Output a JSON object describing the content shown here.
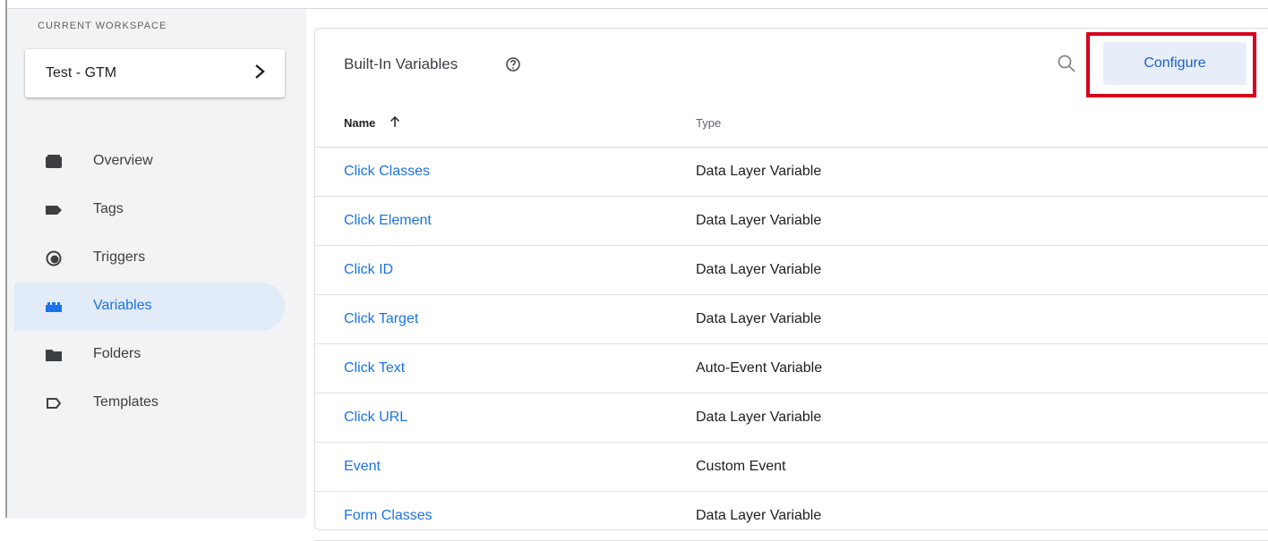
{
  "sidebar": {
    "workspace_label": "CURRENT WORKSPACE",
    "workspace_name": "Test - GTM",
    "items": [
      {
        "label": "Overview",
        "icon": "overview-icon",
        "active": false
      },
      {
        "label": "Tags",
        "icon": "tag-icon",
        "active": false
      },
      {
        "label": "Triggers",
        "icon": "trigger-icon",
        "active": false
      },
      {
        "label": "Variables",
        "icon": "variables-icon",
        "active": true
      },
      {
        "label": "Folders",
        "icon": "folder-icon",
        "active": false
      },
      {
        "label": "Templates",
        "icon": "template-icon",
        "active": false
      }
    ]
  },
  "panel": {
    "title": "Built-In Variables",
    "configure_label": "Configure",
    "columns": {
      "name": "Name",
      "type": "Type"
    },
    "rows": [
      {
        "name": "Click Classes",
        "type": "Data Layer Variable"
      },
      {
        "name": "Click Element",
        "type": "Data Layer Variable"
      },
      {
        "name": "Click ID",
        "type": "Data Layer Variable"
      },
      {
        "name": "Click Target",
        "type": "Data Layer Variable"
      },
      {
        "name": "Click Text",
        "type": "Auto-Event Variable"
      },
      {
        "name": "Click URL",
        "type": "Data Layer Variable"
      },
      {
        "name": "Event",
        "type": "Custom Event"
      },
      {
        "name": "Form Classes",
        "type": "Data Layer Variable"
      }
    ]
  },
  "colors": {
    "accent": "#1a73e8",
    "active_nav_bg": "#e2ebf8",
    "highlight_border": "#d6001c",
    "configure_bg": "#e8eef9"
  }
}
